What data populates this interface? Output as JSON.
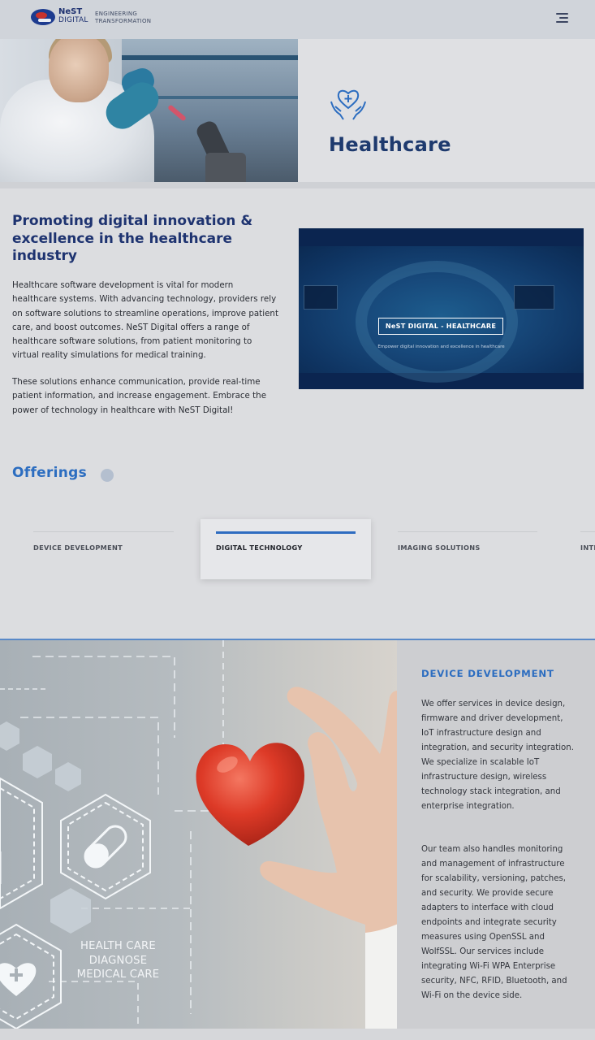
{
  "header": {
    "logo_line1": "NeST",
    "logo_line2": "DIGITAL",
    "tagline_line1": "ENGINEERING",
    "tagline_line2": "TRANSFORMATION",
    "menu_icon": "hamburger-menu-icon"
  },
  "hero": {
    "icon": "hands-heart-icon",
    "title": "Healthcare"
  },
  "intro": {
    "heading": "Promoting digital innovation & excellence in the healthcare industry",
    "paragraph1": "Healthcare software development is vital for modern healthcare systems. With advancing technology, providers rely on software solutions to streamline operations, improve patient care, and boost outcomes. NeST Digital offers a range of healthcare software solutions, from patient monitoring to virtual reality simulations for medical training.",
    "paragraph2": "These solutions enhance communication, provide real-time patient information, and increase engagement. Embrace the power of technology in healthcare with NeST Digital!"
  },
  "video": {
    "title": "NeST DIGITAL - HEALTHCARE",
    "subtitle": "Empower digital innovation and excellence in healthcare"
  },
  "offerings": {
    "title": "Offerings",
    "tabs": [
      {
        "label": "DEVICE DEVELOPMENT"
      },
      {
        "label": "DIGITAL TECHNOLOGY"
      },
      {
        "label": "IMAGING SOLUTIONS"
      },
      {
        "label": "INTE"
      }
    ],
    "active_tab": "DIGITAL TECHNOLOGY"
  },
  "feature": {
    "image_text_line1": "HEALTH CARE",
    "image_text_line2": "DIAGNOSE",
    "image_text_line3": "MEDICAL CARE",
    "heading": "DEVICE DEVELOPMENT",
    "paragraph1": "We offer services in device design, firmware and driver development, IoT infrastructure design and integration, and security integration. We specialize in scalable IoT infrastructure design, wireless technology stack integration, and enterprise integration.",
    "paragraph2": "Our team also handles monitoring and management of infrastructure for scalability, versioning, patches, and security. We provide secure adapters to interface with cloud endpoints and integrate security measures using OpenSSL and WolfSSL. Our services include integrating Wi-Fi WPA Enterprise security, NFC, RFID, Bluetooth, and Wi-Fi on the device side."
  },
  "colors": {
    "brand_navy": "#1e3370",
    "accent_blue": "#2c6dc0",
    "header_bg": "#d0d4da"
  }
}
